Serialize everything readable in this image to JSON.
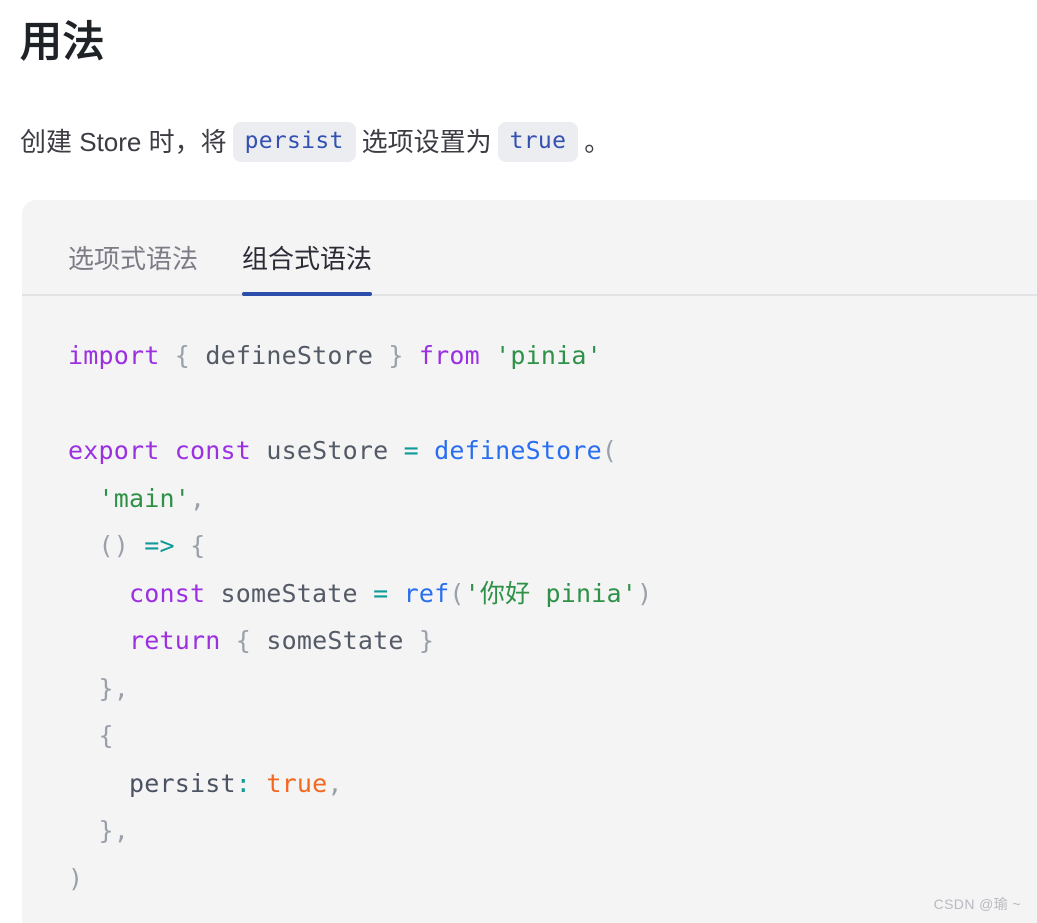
{
  "page": {
    "heading": "用法",
    "watermark": "CSDN @瑜 ~"
  },
  "intro": {
    "part1": "创建 Store 时，将",
    "chip1": "persist",
    "part2": "选项设置为",
    "chip2": "true",
    "part3": "。"
  },
  "tabs": [
    {
      "label": "选项式语法",
      "active": false
    },
    {
      "label": "组合式语法",
      "active": true
    }
  ],
  "code": {
    "language": "javascript",
    "full_text": "import { defineStore } from 'pinia'\n\nexport const useStore = defineStore(\n  'main',\n  () => {\n    const someState = ref('你好 pinia')\n    return { someState }\n  },\n  {\n    persist: true,\n  },\n)",
    "lines": [
      {
        "n": 1,
        "tokens": [
          {
            "t": "import",
            "c": "kw"
          },
          {
            "t": " ",
            "c": "plain"
          },
          {
            "t": "{",
            "c": "punct"
          },
          {
            "t": " ",
            "c": "plain"
          },
          {
            "t": "defineStore",
            "c": "ident"
          },
          {
            "t": " ",
            "c": "plain"
          },
          {
            "t": "}",
            "c": "punct"
          },
          {
            "t": " ",
            "c": "plain"
          },
          {
            "t": "from",
            "c": "kw"
          },
          {
            "t": " ",
            "c": "plain"
          },
          {
            "t": "'pinia'",
            "c": "str"
          }
        ]
      },
      {
        "n": 2,
        "tokens": []
      },
      {
        "n": 3,
        "tokens": [
          {
            "t": "export",
            "c": "kw"
          },
          {
            "t": " ",
            "c": "plain"
          },
          {
            "t": "const",
            "c": "kw"
          },
          {
            "t": " ",
            "c": "plain"
          },
          {
            "t": "useStore",
            "c": "ident"
          },
          {
            "t": " ",
            "c": "plain"
          },
          {
            "t": "=",
            "c": "op"
          },
          {
            "t": " ",
            "c": "plain"
          },
          {
            "t": "defineStore",
            "c": "fn"
          },
          {
            "t": "(",
            "c": "punct"
          }
        ]
      },
      {
        "n": 4,
        "tokens": [
          {
            "t": "  ",
            "c": "plain"
          },
          {
            "t": "'main'",
            "c": "str"
          },
          {
            "t": ",",
            "c": "punct"
          }
        ]
      },
      {
        "n": 5,
        "tokens": [
          {
            "t": "  ",
            "c": "plain"
          },
          {
            "t": "()",
            "c": "punct"
          },
          {
            "t": " ",
            "c": "plain"
          },
          {
            "t": "=>",
            "c": "op"
          },
          {
            "t": " ",
            "c": "plain"
          },
          {
            "t": "{",
            "c": "punct"
          }
        ]
      },
      {
        "n": 6,
        "tokens": [
          {
            "t": "    ",
            "c": "plain"
          },
          {
            "t": "const",
            "c": "kw"
          },
          {
            "t": " ",
            "c": "plain"
          },
          {
            "t": "someState",
            "c": "ident"
          },
          {
            "t": " ",
            "c": "plain"
          },
          {
            "t": "=",
            "c": "op"
          },
          {
            "t": " ",
            "c": "plain"
          },
          {
            "t": "ref",
            "c": "fn"
          },
          {
            "t": "(",
            "c": "punct"
          },
          {
            "t": "'你好 pinia'",
            "c": "str"
          },
          {
            "t": ")",
            "c": "punct"
          }
        ]
      },
      {
        "n": 7,
        "tokens": [
          {
            "t": "    ",
            "c": "plain"
          },
          {
            "t": "return",
            "c": "kw"
          },
          {
            "t": " ",
            "c": "plain"
          },
          {
            "t": "{",
            "c": "punct"
          },
          {
            "t": " ",
            "c": "plain"
          },
          {
            "t": "someState",
            "c": "ident"
          },
          {
            "t": " ",
            "c": "plain"
          },
          {
            "t": "}",
            "c": "punct"
          }
        ]
      },
      {
        "n": 8,
        "tokens": [
          {
            "t": "  ",
            "c": "plain"
          },
          {
            "t": "}",
            "c": "punct"
          },
          {
            "t": ",",
            "c": "punct"
          }
        ]
      },
      {
        "n": 9,
        "tokens": [
          {
            "t": "  ",
            "c": "plain"
          },
          {
            "t": "{",
            "c": "punct"
          }
        ]
      },
      {
        "n": 10,
        "tokens": [
          {
            "t": "    ",
            "c": "plain"
          },
          {
            "t": "persist",
            "c": "prop"
          },
          {
            "t": ":",
            "c": "op"
          },
          {
            "t": " ",
            "c": "plain"
          },
          {
            "t": "true",
            "c": "bool"
          },
          {
            "t": ",",
            "c": "punct"
          }
        ]
      },
      {
        "n": 11,
        "tokens": [
          {
            "t": "  ",
            "c": "plain"
          },
          {
            "t": "}",
            "c": "punct"
          },
          {
            "t": ",",
            "c": "punct"
          }
        ]
      },
      {
        "n": 12,
        "tokens": [
          {
            "t": ")",
            "c": "punct"
          }
        ]
      }
    ]
  },
  "colors": {
    "heading": "#1f2328",
    "body_text": "#3c3c43",
    "chip_bg": "#ebedf1",
    "chip_text": "#3451b2",
    "panel_bg": "#f4f4f5",
    "tab_active_underline": "#2b4eaa",
    "tab_inactive_text": "#7c7c86",
    "token_keyword": "#9b30e0",
    "token_string": "#2e9147",
    "token_function": "#2a6ef0",
    "token_operator": "#0f9a9a",
    "token_boolean": "#f4671f",
    "token_punct": "#9aa0aa",
    "watermark": "#b9b9bf"
  }
}
